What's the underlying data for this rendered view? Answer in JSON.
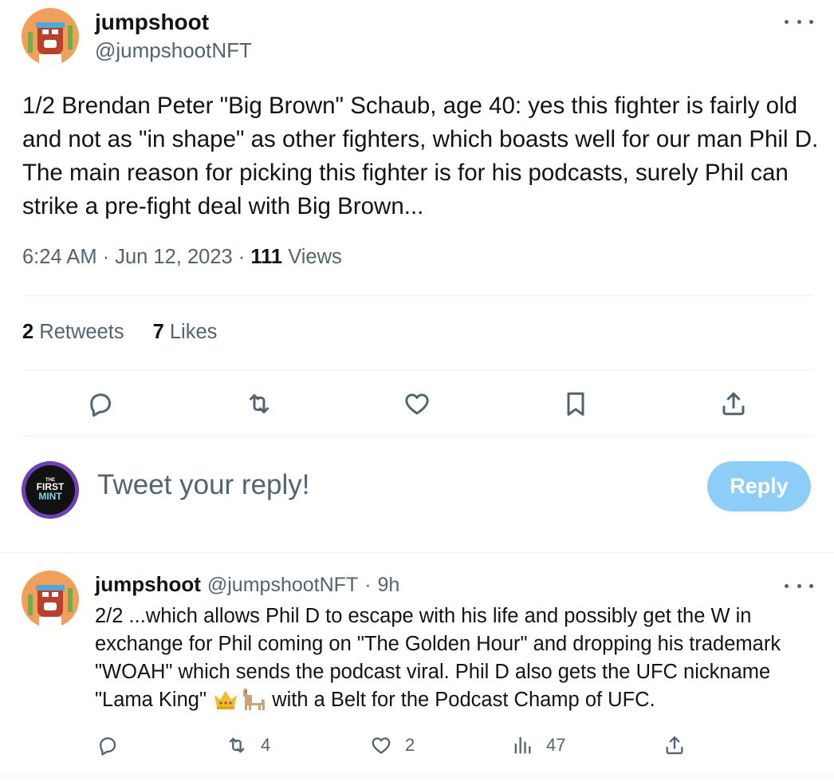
{
  "tweet": {
    "author_name": "jumpshoot",
    "author_handle": "@jumpshootNFT",
    "text": "1/2 Brendan Peter \"Big Brown\" Schaub, age 40: yes this fighter is fairly old and not as \"in shape\" as other fighters, which boasts well for our man Phil D. The main reason for picking this fighter is for his podcasts, surely Phil can strike a pre-fight deal with Big Brown...",
    "time": "6:24 AM",
    "date": "Jun 12, 2023",
    "views_count": "111",
    "views_label": "Views",
    "retweets_count": "2",
    "retweets_label": "Retweets",
    "likes_count": "7",
    "likes_label": "Likes"
  },
  "actions": {
    "icons": [
      "reply-icon",
      "retweet-icon",
      "like-icon",
      "bookmark-icon",
      "share-icon"
    ]
  },
  "composer": {
    "avatar_text_top": "THE",
    "avatar_text_mid": "FIRST",
    "avatar_text_bot": "MINT",
    "placeholder": "Tweet your reply!",
    "reply_label": "Reply"
  },
  "reply": {
    "author_name": "jumpshoot",
    "author_handle": "@jumpshootNFT",
    "separator": "·",
    "time_ago": "9h",
    "text_part1": "2/2 ...which allows Phil D to escape with his life and possibly get the W in exchange for Phil coming on \"The Golden Hour\" and dropping his trademark \"WOAH\" which sends the podcast viral. Phil D also gets the UFC nickname \"Lama King\"",
    "text_part2": "with a Belt for the Podcast Champ of UFC.",
    "emojis": [
      "crown-icon",
      "llama-icon"
    ],
    "retweets": "4",
    "likes": "2",
    "views": "47"
  },
  "colors": {
    "text": "#0f1419",
    "muted": "#536471",
    "reply_button": "#8ecdf7",
    "divider": "#eff3f4"
  }
}
